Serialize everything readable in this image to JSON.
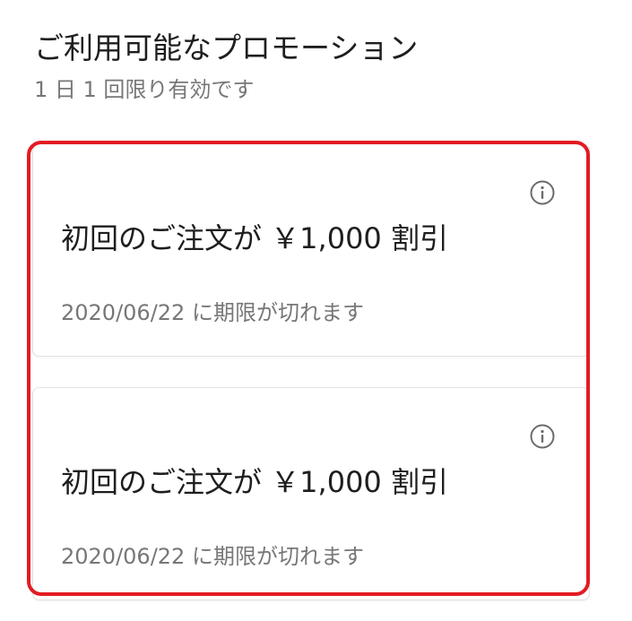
{
  "header": {
    "title": "ご利用可能なプロモーション",
    "subtitle": "1 日 1 回限り有効です"
  },
  "promotions": [
    {
      "title": "初回のご注文が ￥1,000 割引",
      "expiry": "2020/06/22 に期限が切れます",
      "icon": "info-icon"
    },
    {
      "title": "初回のご注文が ￥1,000 割引",
      "expiry": "2020/06/22 に期限が切れます",
      "icon": "info-icon"
    }
  ],
  "colors": {
    "highlight": "#e31b23",
    "text_primary": "#1e1e1e",
    "text_secondary": "#777777",
    "card_border": "#e2e2e2"
  }
}
